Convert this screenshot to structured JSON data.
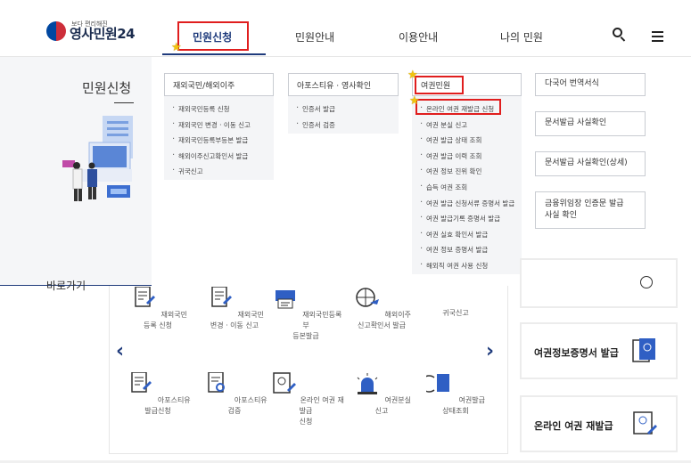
{
  "header": {
    "logo_sub": "보다 편리해진",
    "logo_main": "영사민원24",
    "nav": [
      "민원신청",
      "민원안내",
      "이용안내",
      "나의 민원"
    ]
  },
  "mega": {
    "title": "민원신청",
    "columns": [
      {
        "head": "재외국민/해외이주",
        "items": [
          "재외국민등록 신청",
          "재외국민 변경 · 이동 신고",
          "재외국민등록부등본 발급",
          "해외이주신고확인서 발급",
          "귀국신고"
        ]
      },
      {
        "head": "아포스티유 · 영사확인",
        "items": [
          "인증서 발급",
          "인증서 검증"
        ]
      },
      {
        "head": "여권민원",
        "items": [
          "온라인 여권 재발급 신청",
          "여권 분실 신고",
          "여권 발급 상태 조회",
          "여권 발급 이력 조회",
          "여권 정보 진위 확인",
          "습득 여권 조회",
          "여권 발급 신청서류 증명서 발급",
          "여권 발급기록 증명서 발급",
          "여권 실효 확인서 발급",
          "여권 정보 증명서 발급",
          "해외직 여권 사용 신청"
        ]
      }
    ],
    "side_buttons": [
      "다국어 번역서식",
      "문서발급 사실확인",
      "문서발급 사실확인(상세)",
      "금융위임장 인증문 발급\n사실 확인"
    ]
  },
  "lower": {
    "left_label": "바로가기",
    "services": [
      "재외국민\n등록 신청",
      "재외국민\n변경 · 이동 신고",
      "재외국민등록부\n등본발급",
      "해외이주\n신고확인서 발급",
      "귀국신고",
      "아포스티유\n발급신청",
      "아포스티유\n검증",
      "온라인 여권 재발급\n신청",
      "여권분실\n신고",
      "여권발급\n상태조회"
    ],
    "right_cards": [
      "여권정보증명서 발급",
      "온라인 여권 재발급"
    ]
  },
  "colors": {
    "brand_navy": "#1f3b7c",
    "highlight_red": "#e01e1e",
    "star_yellow": "#f1c40f"
  },
  "icons": [
    "search-icon",
    "hamburger-menu-icon",
    "star-icon",
    "chevron-left-icon",
    "chevron-right-icon"
  ]
}
